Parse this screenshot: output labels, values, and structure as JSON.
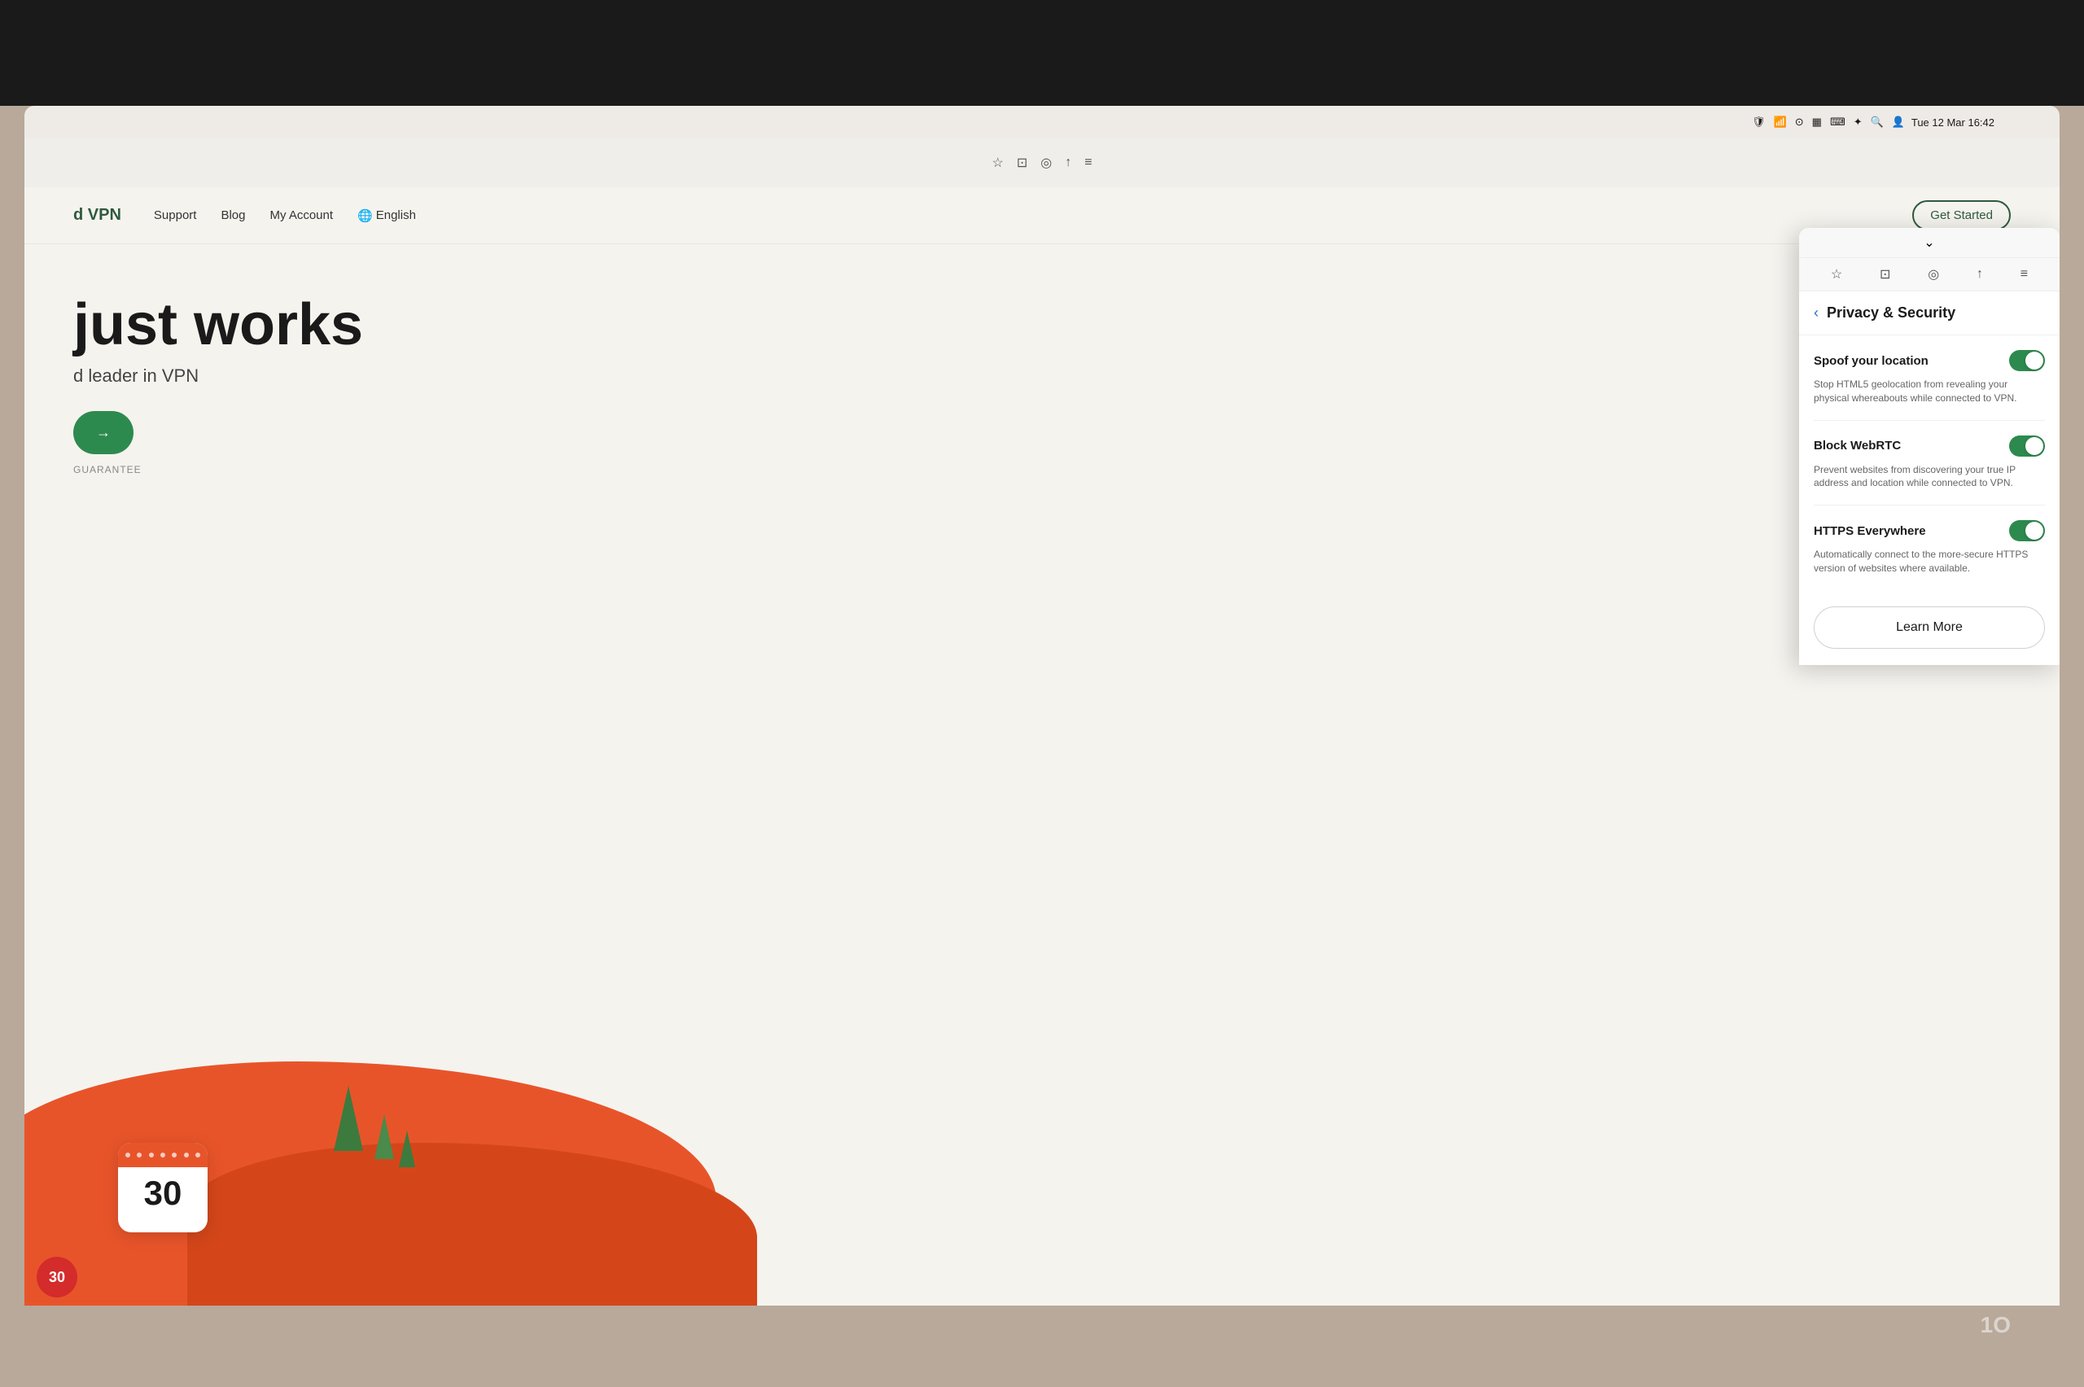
{
  "system": {
    "time": "Tue 12 Mar  16:42",
    "icons": [
      "shield",
      "wifi",
      "focus",
      "bars",
      "keyboard",
      "bluetooth",
      "search",
      "portrait"
    ]
  },
  "browser": {
    "toolbar_icons": [
      "star",
      "pocket",
      "screenshot",
      "share",
      "menu"
    ]
  },
  "website": {
    "nav": {
      "logo": "d VPN",
      "links": [
        "Support",
        "Blog",
        "My Account"
      ],
      "lang": "English",
      "lang_icon": "🌐",
      "cta": "Get Started"
    },
    "hero": {
      "headline_line1": "just works",
      "sub": "d leader in VPN",
      "cta": "→",
      "guarantee": "GUARANTEE"
    },
    "calendar": {
      "number": "30"
    }
  },
  "privacy_panel": {
    "title": "Privacy & Security",
    "back_label": "‹",
    "collapse_icon": "⌄",
    "settings": [
      {
        "name": "Spoof your location",
        "description": "Stop HTML5 geolocation from revealing your physical whereabouts while connected to VPN.",
        "enabled": true
      },
      {
        "name": "Block WebRTC",
        "description": "Prevent websites from discovering your true IP address and location while connected to VPN.",
        "enabled": true
      },
      {
        "name": "HTTPS Everywhere",
        "description": "Automatically connect to the more-secure HTTPS version of websites where available.",
        "enabled": true
      }
    ],
    "learn_more": "Learn More"
  },
  "watermark": "1O"
}
